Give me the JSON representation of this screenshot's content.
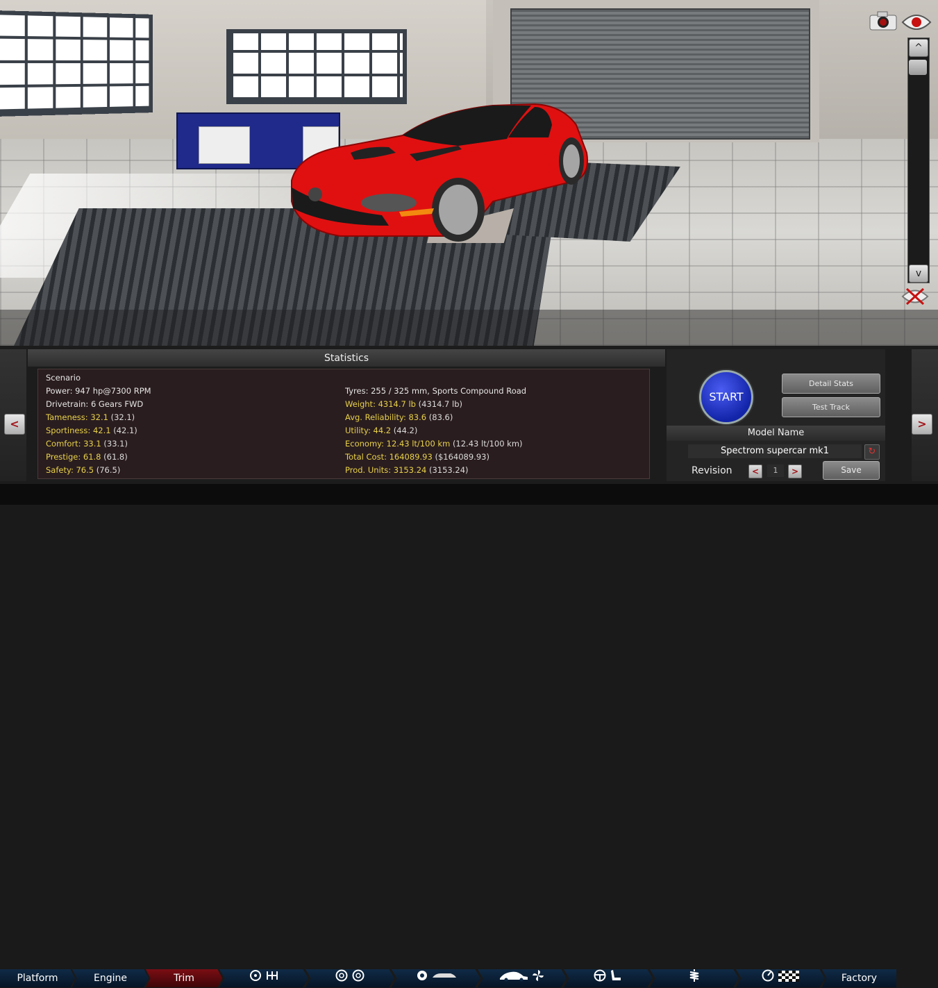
{
  "statistics": {
    "title": "Statistics",
    "left": [
      {
        "label": "Scenario",
        "value": "",
        "paren": "",
        "highlight": false
      },
      {
        "label": "Power: 947 hp@7300 RPM",
        "value": "",
        "paren": "",
        "highlight": false
      },
      {
        "label": "Drivetrain: 6 Gears FWD",
        "value": "",
        "paren": "",
        "highlight": false
      },
      {
        "label": "Tameness: 32.1",
        "value": "",
        "paren": "(32.1)",
        "highlight": true
      },
      {
        "label": "Sportiness: 42.1",
        "value": "",
        "paren": "(42.1)",
        "highlight": true
      },
      {
        "label": "Comfort: 33.1",
        "value": "",
        "paren": "(33.1)",
        "highlight": true
      },
      {
        "label": "Prestige: 61.8",
        "value": "",
        "paren": "(61.8)",
        "highlight": true
      },
      {
        "label": "Safety: 76.5",
        "value": "",
        "paren": "(76.5)",
        "highlight": true
      }
    ],
    "right": [
      {
        "label": "Tyres: 255 / 325 mm, Sports Compound Road",
        "paren": "",
        "highlight": false
      },
      {
        "label": "Weight: 4314.7 lb",
        "paren": "(4314.7 lb)",
        "highlight": true
      },
      {
        "label": "Avg. Reliability: 83.6",
        "paren": "(83.6)",
        "highlight": true
      },
      {
        "label": "Utility: 44.2",
        "paren": "(44.2)",
        "highlight": true
      },
      {
        "label": "Economy: 12.43 lt/100 km",
        "paren": "(12.43 lt/100 km)",
        "highlight": true
      },
      {
        "label": "Total Cost: 164089.93",
        "paren": "($164089.93)",
        "highlight": true
      },
      {
        "label": "Prod. Units: 3153.24",
        "paren": "(3153.24)",
        "highlight": true
      }
    ]
  },
  "actions": {
    "start": "START",
    "detail_stats": "Detail Stats",
    "test_track": "Test Track",
    "model_name_title": "Model Name",
    "model_name_value": "Spectrom supercar mk1",
    "revision_label": "Revision",
    "revision_value": "1",
    "save": "Save"
  },
  "nav": {
    "prev_glyph": "<",
    "next_glyph": ">",
    "scroll_up_glyph": "^",
    "scroll_down_glyph": "v"
  },
  "tabs": [
    {
      "label": "Platform",
      "icons": []
    },
    {
      "label": "Engine",
      "icons": []
    },
    {
      "label": "Trim",
      "icons": []
    },
    {
      "label": "",
      "icons": [
        "crankshaft-icon",
        "gearbox-icon"
      ]
    },
    {
      "label": "",
      "icons": [
        "wheel-icon",
        "wheel-icon"
      ]
    },
    {
      "label": "",
      "icons": [
        "brake-disc-icon",
        "car-body-icon"
      ]
    },
    {
      "label": "",
      "icons": [
        "car-profile-icon",
        "fan-icon"
      ]
    },
    {
      "label": "",
      "icons": [
        "steering-wheel-icon",
        "seat-icon"
      ]
    },
    {
      "label": "",
      "icons": [
        "suspension-spring-icon"
      ]
    },
    {
      "label": "",
      "icons": [
        "gauge-icon",
        "checkered-flag-icon"
      ]
    },
    {
      "label": "Factory",
      "icons": []
    }
  ],
  "colors": {
    "highlight": "#e8d24a",
    "active_tab": "#7a0e14",
    "start_button": "#1e32c8",
    "car": "#e01010"
  }
}
